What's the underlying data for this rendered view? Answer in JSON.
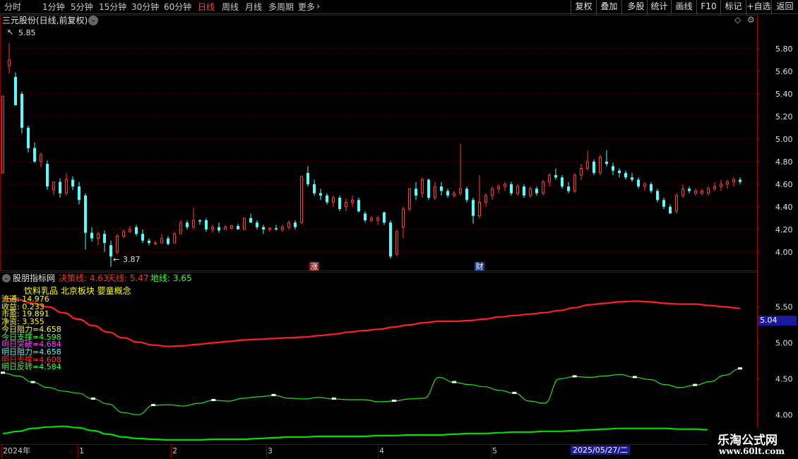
{
  "toolbar": {
    "timeframes": [
      "分时",
      "1分钟",
      "5分钟",
      "15分钟",
      "30分钟",
      "60分钟",
      "日线",
      "周线",
      "月线",
      "多周期",
      "更多"
    ],
    "active_timeframe": "日线",
    "more_chevron": "›",
    "right_buttons": [
      "复权",
      "叠加",
      "多股",
      "统计",
      "画线",
      "F10",
      "标记",
      "+自选",
      "返回"
    ]
  },
  "main": {
    "title": "三元股份(日线,前复权)",
    "high_marker": "5.85",
    "low_marker": "3.87",
    "event_zhang": "涨",
    "event_cai": "财",
    "y_ticks": [
      "5.80",
      "5.60",
      "5.40",
      "5.20",
      "5.00",
      "4.80",
      "4.60",
      "4.40",
      "4.20",
      "4.00"
    ],
    "y_values": [
      5.8,
      5.6,
      5.4,
      5.2,
      5.0,
      4.8,
      4.6,
      4.4,
      4.2,
      4.0
    ]
  },
  "indicator": {
    "name": "股朋指标网",
    "decision_line": "决策线: 4.63",
    "sky_line": "天线: 5.47",
    "ground_line": "地线: 3.65",
    "tags": "饮料乳品 北京板块 婴童概念",
    "info_lines": [
      {
        "text": "流通: 14.976",
        "color": "#ffff00"
      },
      {
        "text": "收益: 0.233",
        "color": "#ffff00"
      },
      {
        "text": "市盈: 19.891",
        "color": "#ffff00"
      },
      {
        "text": "净资: 3.355",
        "color": "#ffff00"
      },
      {
        "text": "今日阻力=4.658",
        "color": "#ffff00"
      },
      {
        "text": "今日支撑=4.598",
        "color": "#40ff40"
      },
      {
        "text": "明日突破=4.684",
        "color": "#ff40ff"
      },
      {
        "text": "明日阻力=4.658",
        "color": "#40ffff"
      },
      {
        "text": "明日支撑=4.608",
        "color": "#ff3030"
      },
      {
        "text": "明日反转=4.584",
        "color": "#40ff40"
      }
    ],
    "current_value": "5.04",
    "y_ticks": [
      "5.50",
      "5.00",
      "4.50",
      "4.00"
    ],
    "y_values": [
      5.5,
      5.0,
      4.5,
      4.0
    ]
  },
  "xaxis": {
    "labels": [
      "2024年",
      "1",
      "2",
      "3",
      "4",
      "5"
    ],
    "cursor_date": "2025/05/27/二"
  },
  "watermark": {
    "title": "乐淘公式网",
    "url": "www.60lt.com"
  },
  "colors": {
    "up": "#ff3b3b",
    "down": "#54ffff",
    "grid": "#800000",
    "decision": "#ff2020",
    "ground": "#00e000",
    "mid": "#20e020"
  },
  "chart_data": [
    {
      "type": "candlestick",
      "title": "三元股份(日线,前复权)",
      "ylim": [
        3.88,
        5.95
      ],
      "ohlc": [
        [
          4.7,
          5.38,
          4.72,
          5.38
        ],
        [
          5.65,
          5.85,
          5.58,
          5.7
        ],
        [
          5.55,
          5.59,
          5.3,
          5.3
        ],
        [
          5.4,
          5.42,
          5.05,
          5.1
        ],
        [
          5.1,
          5.12,
          4.88,
          4.92
        ],
        [
          4.92,
          4.97,
          4.79,
          4.8
        ],
        [
          4.8,
          4.88,
          4.75,
          4.86
        ],
        [
          4.78,
          4.81,
          4.55,
          4.58
        ],
        [
          4.55,
          4.62,
          4.5,
          4.62
        ],
        [
          4.62,
          4.65,
          4.48,
          4.52
        ],
        [
          4.52,
          4.7,
          4.5,
          4.64
        ],
        [
          4.64,
          4.67,
          4.55,
          4.58
        ],
        [
          4.58,
          4.62,
          4.42,
          4.46
        ],
        [
          4.5,
          4.52,
          4.02,
          4.17
        ],
        [
          4.17,
          4.22,
          4.09,
          4.12
        ],
        [
          4.12,
          4.18,
          4.06,
          4.16
        ],
        [
          4.16,
          4.19,
          4.0,
          4.08
        ],
        [
          4.06,
          4.1,
          3.87,
          3.96
        ],
        [
          4.0,
          4.16,
          3.98,
          4.14
        ],
        [
          4.14,
          4.2,
          4.12,
          4.18
        ],
        [
          4.18,
          4.23,
          4.17,
          4.2
        ],
        [
          4.22,
          4.24,
          4.14,
          4.16
        ],
        [
          4.16,
          4.2,
          4.08,
          4.1
        ],
        [
          4.1,
          4.12,
          4.06,
          4.08
        ],
        [
          4.08,
          4.1,
          4.06,
          4.08
        ],
        [
          4.08,
          4.16,
          4.08,
          4.12
        ],
        [
          4.12,
          4.14,
          4.06,
          4.07
        ],
        [
          4.08,
          4.18,
          4.08,
          4.16
        ],
        [
          4.16,
          4.28,
          4.16,
          4.26
        ],
        [
          4.26,
          4.28,
          4.2,
          4.22
        ],
        [
          4.22,
          4.39,
          4.2,
          4.28
        ],
        [
          4.28,
          4.29,
          4.24,
          4.27
        ],
        [
          4.28,
          4.3,
          4.18,
          4.2
        ],
        [
          4.2,
          4.24,
          4.17,
          4.22
        ],
        [
          4.22,
          4.26,
          4.17,
          4.19
        ],
        [
          4.2,
          4.24,
          4.2,
          4.22
        ],
        [
          4.21,
          4.24,
          4.2,
          4.23
        ],
        [
          4.23,
          4.25,
          4.2,
          4.2
        ],
        [
          4.2,
          4.3,
          4.2,
          4.3
        ],
        [
          4.3,
          4.34,
          4.26,
          4.26
        ],
        [
          4.26,
          4.28,
          4.2,
          4.22
        ],
        [
          4.22,
          4.24,
          4.16,
          4.2
        ],
        [
          4.2,
          4.22,
          4.18,
          4.21
        ],
        [
          4.21,
          4.24,
          4.19,
          4.2
        ],
        [
          4.2,
          4.24,
          4.18,
          4.22
        ],
        [
          4.22,
          4.28,
          4.2,
          4.26
        ],
        [
          4.26,
          4.28,
          4.2,
          4.22
        ],
        [
          4.26,
          4.67,
          4.25,
          4.67
        ],
        [
          4.7,
          4.76,
          4.58,
          4.6
        ],
        [
          4.6,
          4.64,
          4.5,
          4.52
        ],
        [
          4.52,
          4.56,
          4.46,
          4.5
        ],
        [
          4.5,
          4.52,
          4.42,
          4.44
        ],
        [
          4.44,
          4.5,
          4.4,
          4.48
        ],
        [
          4.48,
          4.5,
          4.36,
          4.38
        ],
        [
          4.4,
          4.47,
          4.36,
          4.44
        ],
        [
          4.44,
          4.5,
          4.4,
          4.46
        ],
        [
          4.46,
          4.48,
          4.35,
          4.36
        ],
        [
          4.34,
          4.36,
          4.26,
          4.28
        ],
        [
          4.28,
          4.32,
          4.26,
          4.3
        ],
        [
          4.28,
          4.32,
          4.24,
          4.3
        ],
        [
          4.35,
          4.36,
          4.24,
          4.26
        ],
        [
          4.26,
          4.28,
          3.94,
          3.96
        ],
        [
          3.98,
          4.2,
          3.96,
          4.18
        ],
        [
          4.22,
          4.4,
          4.12,
          4.38
        ],
        [
          4.38,
          4.56,
          4.36,
          4.56
        ],
        [
          4.56,
          4.62,
          4.46,
          4.5
        ],
        [
          4.52,
          4.66,
          4.48,
          4.64
        ],
        [
          4.64,
          4.65,
          4.46,
          4.48
        ],
        [
          4.48,
          4.62,
          4.46,
          4.58
        ],
        [
          4.58,
          4.62,
          4.5,
          4.54
        ],
        [
          4.54,
          4.56,
          4.48,
          4.5
        ],
        [
          4.5,
          4.54,
          4.48,
          4.52
        ],
        [
          4.52,
          4.96,
          4.5,
          4.56
        ],
        [
          4.56,
          4.58,
          4.44,
          4.46
        ],
        [
          4.46,
          4.48,
          4.25,
          4.32
        ],
        [
          4.32,
          4.68,
          4.3,
          4.44
        ],
        [
          4.44,
          4.52,
          4.4,
          4.5
        ],
        [
          4.5,
          4.58,
          4.46,
          4.56
        ],
        [
          4.56,
          4.6,
          4.52,
          4.58
        ],
        [
          4.58,
          4.62,
          4.54,
          4.6
        ],
        [
          4.6,
          4.62,
          4.5,
          4.52
        ],
        [
          4.52,
          4.6,
          4.5,
          4.58
        ],
        [
          4.58,
          4.6,
          4.48,
          4.5
        ],
        [
          4.5,
          4.58,
          4.48,
          4.56
        ],
        [
          4.56,
          4.58,
          4.5,
          4.52
        ],
        [
          4.52,
          4.64,
          4.5,
          4.62
        ],
        [
          4.62,
          4.7,
          4.58,
          4.68
        ],
        [
          4.68,
          4.74,
          4.64,
          4.66
        ],
        [
          4.66,
          4.68,
          4.56,
          4.58
        ],
        [
          4.58,
          4.62,
          4.52,
          4.54
        ],
        [
          4.54,
          4.7,
          4.52,
          4.68
        ],
        [
          4.68,
          4.78,
          4.64,
          4.74
        ],
        [
          4.74,
          4.9,
          4.72,
          4.8
        ],
        [
          4.8,
          4.82,
          4.68,
          4.7
        ],
        [
          4.7,
          4.86,
          4.68,
          4.84
        ],
        [
          4.8,
          4.9,
          4.76,
          4.78
        ],
        [
          4.76,
          4.79,
          4.68,
          4.72
        ],
        [
          4.72,
          4.74,
          4.66,
          4.7
        ],
        [
          4.7,
          4.72,
          4.64,
          4.66
        ],
        [
          4.66,
          4.7,
          4.62,
          4.64
        ],
        [
          4.64,
          4.66,
          4.56,
          4.58
        ],
        [
          4.58,
          4.62,
          4.54,
          4.6
        ],
        [
          4.6,
          4.62,
          4.52,
          4.54
        ],
        [
          4.54,
          4.56,
          4.44,
          4.46
        ],
        [
          4.46,
          4.48,
          4.38,
          4.4
        ],
        [
          4.4,
          4.42,
          4.34,
          4.34
        ],
        [
          4.36,
          4.52,
          4.34,
          4.5
        ],
        [
          4.5,
          4.6,
          4.48,
          4.56
        ],
        [
          4.56,
          4.58,
          4.52,
          4.54
        ],
        [
          4.52,
          4.56,
          4.5,
          4.54
        ],
        [
          4.52,
          4.56,
          4.5,
          4.54
        ],
        [
          4.52,
          4.58,
          4.5,
          4.56
        ],
        [
          4.56,
          4.62,
          4.54,
          4.58
        ],
        [
          4.58,
          4.64,
          4.54,
          4.6
        ],
        [
          4.6,
          4.64,
          4.56,
          4.62
        ],
        [
          4.62,
          4.66,
          4.58,
          4.64
        ],
        [
          4.64,
          4.66,
          4.6,
          4.62
        ]
      ]
    },
    {
      "type": "line",
      "title": "股朋指标网",
      "ylim": [
        3.65,
        5.85
      ],
      "series": [
        {
          "name": "天线",
          "color": "#ff2020",
          "values": [
            5.62,
            5.6,
            5.55,
            5.5,
            5.42,
            5.33,
            5.24,
            5.15,
            5.07,
            5.01,
            4.97,
            4.95,
            4.96,
            4.98,
            5.0,
            5.02,
            5.04,
            5.05,
            5.06,
            5.07,
            5.08,
            5.1,
            5.12,
            5.15,
            5.17,
            5.19,
            5.22,
            5.25,
            5.28,
            5.3,
            5.3,
            5.31,
            5.33,
            5.36,
            5.38,
            5.4,
            5.42,
            5.45,
            5.49,
            5.53,
            5.55,
            5.57,
            5.58,
            5.57,
            5.55,
            5.54,
            5.54,
            5.52,
            5.5,
            5.48
          ]
        },
        {
          "name": "决策线",
          "color": "#20e020",
          "values": [
            4.58,
            4.54,
            4.45,
            4.38,
            4.33,
            4.3,
            4.22,
            4.15,
            4.03,
            4.0,
            4.13,
            4.14,
            4.12,
            4.16,
            4.2,
            4.19,
            4.23,
            4.25,
            4.27,
            4.23,
            4.22,
            4.24,
            4.22,
            4.21,
            4.21,
            4.18,
            4.19,
            4.22,
            4.23,
            4.52,
            4.45,
            4.42,
            4.39,
            4.34,
            4.3,
            4.19,
            4.16,
            4.5,
            4.53,
            4.52,
            4.54,
            4.56,
            4.52,
            4.49,
            4.42,
            4.38,
            4.41,
            4.46,
            4.55,
            4.64
          ]
        },
        {
          "name": "地线",
          "color": "#00e000",
          "values": [
            3.74,
            3.77,
            3.81,
            3.83,
            3.84,
            3.82,
            3.78,
            3.73,
            3.69,
            3.67,
            3.66,
            3.65,
            3.65,
            3.65,
            3.66,
            3.66,
            3.66,
            3.67,
            3.68,
            3.69,
            3.69,
            3.7,
            3.7,
            3.7,
            3.7,
            3.71,
            3.71,
            3.72,
            3.72,
            3.72,
            3.73,
            3.74,
            3.74,
            3.75,
            3.76,
            3.76,
            3.77,
            3.77,
            3.78,
            3.79,
            3.8,
            3.81,
            3.81,
            3.81,
            3.81,
            3.8,
            3.8,
            3.79,
            3.79,
            3.78
          ]
        }
      ]
    }
  ]
}
